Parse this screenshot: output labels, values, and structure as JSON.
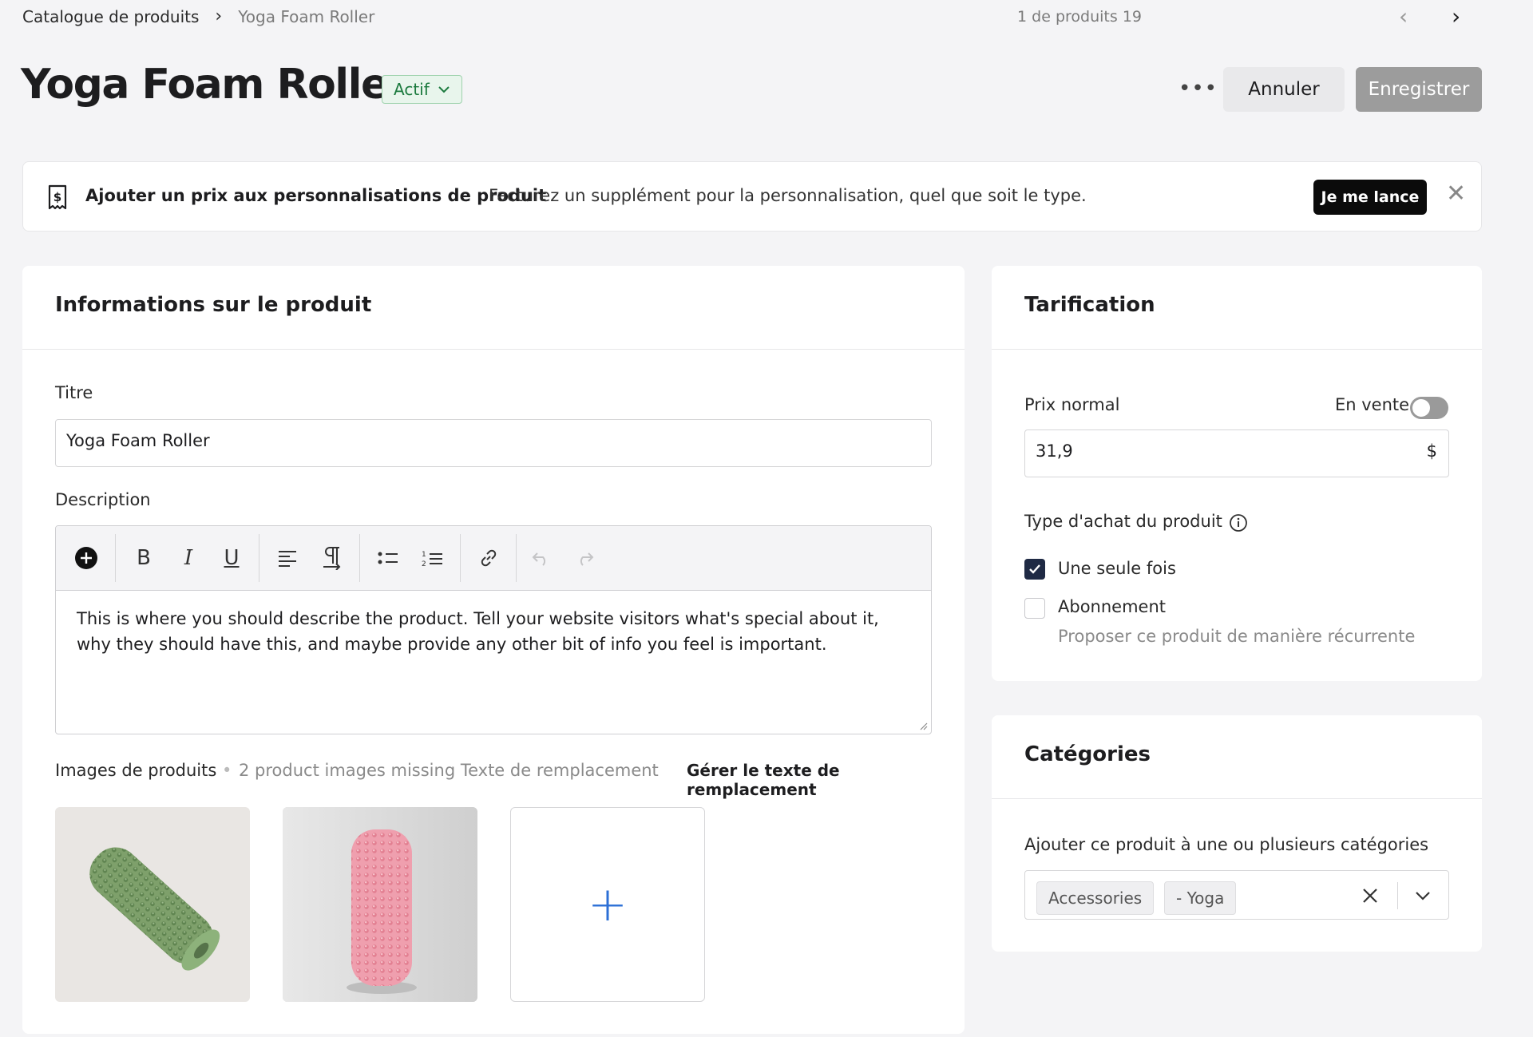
{
  "breadcrumb": {
    "parent": "Catalogue de produits",
    "current": "Yoga Foam Roller"
  },
  "pager": {
    "text": "1 de produits 19"
  },
  "header": {
    "title": "Yoga Foam Roller",
    "status": "Actif",
    "more": "•••",
    "cancel_label": "Annuler",
    "save_label": "Enregistrer"
  },
  "banner": {
    "title": "Ajouter un prix aux personnalisations de produit",
    "text": "Facturez un supplément pour la personnalisation, quel que soit le type.",
    "cta": "Je me lance",
    "close": "✕"
  },
  "product_info": {
    "heading": "Informations sur le produit",
    "title_label": "Titre",
    "title_value": "Yoga Foam Roller",
    "description_label": "Description",
    "description_text": "This is where you should describe the product. Tell your website visitors what's special about it, why they should have this, and maybe provide any other bit of info you feel is important.",
    "toolbar": {
      "bold": "B",
      "italic": "I",
      "underline": "U"
    },
    "images_label": "Images de produits",
    "images_separator": "•",
    "images_warning": "2 product images missing Texte de remplacement",
    "images_link": "Gérer le texte de remplacement",
    "add_image": "+"
  },
  "pricing": {
    "heading": "Tarification",
    "price_label": "Prix normal",
    "sale_label": "En vente",
    "sale_on": false,
    "price_value": "31,9",
    "currency": "$",
    "purchase_type_label": "Type d'achat du produit",
    "options": [
      {
        "label": "Une seule fois",
        "checked": true
      },
      {
        "label": "Abonnement",
        "checked": false,
        "hint": "Proposer ce produit de manière récurrente"
      }
    ]
  },
  "categories": {
    "heading": "Catégories",
    "label": "Ajouter ce produit à une ou plusieurs catégories",
    "chips": [
      "Accessories",
      "- Yoga"
    ]
  },
  "colors": {
    "status_bg": "#e8f5ec",
    "status_text": "#1b7a3e",
    "accent": "#2c6fd6",
    "save_disabled": "#9c9c9c"
  }
}
